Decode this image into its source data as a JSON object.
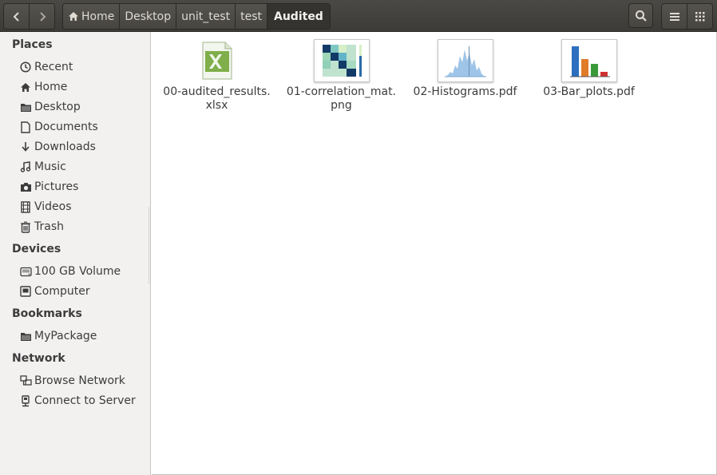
{
  "breadcrumbs": [
    {
      "label": "Home",
      "icon": "home-icon"
    },
    {
      "label": "Desktop"
    },
    {
      "label": "unit_test"
    },
    {
      "label": "test"
    },
    {
      "label": "Audited",
      "current": true
    }
  ],
  "sidebar": {
    "places": {
      "title": "Places",
      "items": [
        {
          "label": "Recent",
          "icon": "clock-icon"
        },
        {
          "label": "Home",
          "icon": "home-icon"
        },
        {
          "label": "Desktop",
          "icon": "folder-icon"
        },
        {
          "label": "Documents",
          "icon": "document-icon"
        },
        {
          "label": "Downloads",
          "icon": "download-icon"
        },
        {
          "label": "Music",
          "icon": "music-icon"
        },
        {
          "label": "Pictures",
          "icon": "camera-icon"
        },
        {
          "label": "Videos",
          "icon": "film-icon"
        },
        {
          "label": "Trash",
          "icon": "trash-icon"
        }
      ]
    },
    "devices": {
      "title": "Devices",
      "items": [
        {
          "label": "100 GB Volume",
          "icon": "drive-icon"
        },
        {
          "label": "Computer",
          "icon": "computer-icon"
        }
      ]
    },
    "bookmarks": {
      "title": "Bookmarks",
      "items": [
        {
          "label": "MyPackage",
          "icon": "folder-icon"
        }
      ]
    },
    "network": {
      "title": "Network",
      "items": [
        {
          "label": "Browse Network",
          "icon": "network-icon"
        },
        {
          "label": "Connect to Server",
          "icon": "server-icon"
        }
      ]
    }
  },
  "files": [
    {
      "name_line1": "00-audited_results.",
      "name_line2": "xlsx",
      "icon": "spreadsheet-icon"
    },
    {
      "name_line1": "01-correlation_mat.",
      "name_line2": "png",
      "icon": "correlation-matrix-thumbnail"
    },
    {
      "name_line1": "02-Histograms.pdf",
      "name_line2": "",
      "icon": "histogram-thumbnail"
    },
    {
      "name_line1": "03-Bar_plots.pdf",
      "name_line2": "",
      "icon": "bar-plot-thumbnail"
    }
  ],
  "colors": {
    "headerbar": "#3c3b37",
    "sidebar_bg": "#f2f1f0",
    "spreadsheet_green": "#6a9a3a",
    "bar_blue": "#2c6fbf",
    "bar_orange": "#e07b2a",
    "bar_green": "#3a9a3a",
    "bar_red": "#d03030"
  }
}
